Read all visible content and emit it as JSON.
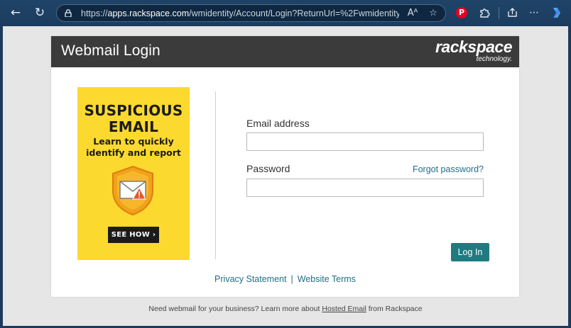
{
  "browser": {
    "url_prefix": "https://",
    "url_host": "apps.rackspace.com",
    "url_path": "/wmidentity/Account/Login?ReturnUrl=%2Fwmidentity%2F...",
    "read_aloud_icon": "Aᴬ",
    "accent_color": "#1c3a5c"
  },
  "header": {
    "title": "Webmail Login",
    "brand_main": "rackspace",
    "brand_sub": "technology."
  },
  "ad": {
    "headline_line1": "SUSPICIOUS",
    "headline_line2": "EMAIL",
    "sub_line1": "Learn to quickly",
    "sub_line2": "identify and report",
    "cta": "SEE HOW ›",
    "background_color": "#fcd92f"
  },
  "form": {
    "email_label": "Email address",
    "email_value": "",
    "password_label": "Password",
    "password_value": "",
    "forgot_link": "Forgot password?",
    "login_button": "Log In",
    "button_color": "#1f7b80"
  },
  "footer": {
    "privacy": "Privacy Statement",
    "separator": "|",
    "terms": "Website Terms",
    "note_before": "Need webmail for your business? Learn more about ",
    "note_link": "Hosted Email",
    "note_after": " from Rackspace"
  }
}
